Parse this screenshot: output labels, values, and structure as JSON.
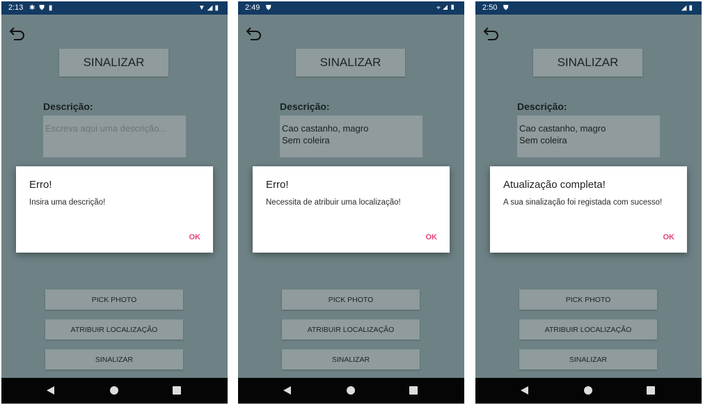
{
  "colors": {
    "status_bar": "#123a63",
    "app_background": "#6e8285",
    "button": "#8f9b9c",
    "dialog_accent": "#e8427c",
    "nav_bar": "#050505"
  },
  "screens": [
    {
      "time": "2:13",
      "status_left_icons": [
        "gear-icon",
        "shield-icon",
        "sd-card-icon"
      ],
      "status_right_icons": [
        "wifi-icon",
        "signal-icon",
        "battery-icon"
      ],
      "title_button": "SINALIZAR",
      "description_label": "Descrição:",
      "description_value": "",
      "description_placeholder": "Escreva aqui uma descrição...",
      "buttons": {
        "pick_photo": "PICK PHOTO",
        "assign_location": "ATRIBUIR LOCALIZAÇÃO",
        "submit": "SINALIZAR"
      },
      "dialog": {
        "title": "Erro!",
        "message": "Insira uma descrição!",
        "ok": "OK"
      }
    },
    {
      "time": "2:49",
      "status_left_icons": [
        "shield-icon"
      ],
      "status_right_icons": [
        "location-icon",
        "signal-icon",
        "battery-icon"
      ],
      "title_button": "SINALIZAR",
      "description_label": "Descrição:",
      "description_value": "Cao castanho, magro\nSem coleira",
      "description_placeholder": "",
      "buttons": {
        "pick_photo": "PICK PHOTO",
        "assign_location": "ATRIBUIR LOCALIZAÇÃO",
        "submit": "SINALIZAR"
      },
      "dialog": {
        "title": "Erro!",
        "message": "Necessita de atribuir uma localização!",
        "ok": "OK"
      }
    },
    {
      "time": "2:50",
      "status_left_icons": [
        "shield-icon"
      ],
      "status_right_icons": [
        "signal-icon",
        "battery-icon"
      ],
      "title_button": "SINALIZAR",
      "description_label": "Descrição:",
      "description_value": "Cao castanho, magro\nSem coleira",
      "description_placeholder": "",
      "buttons": {
        "pick_photo": "PICK PHOTO",
        "assign_location": "ATRIBUIR LOCALIZAÇÃO",
        "submit": "SINALIZAR"
      },
      "dialog": {
        "title": "Atualização completa!",
        "message": "A sua sinalização foi registada com sucesso!",
        "ok": "OK"
      }
    }
  ]
}
